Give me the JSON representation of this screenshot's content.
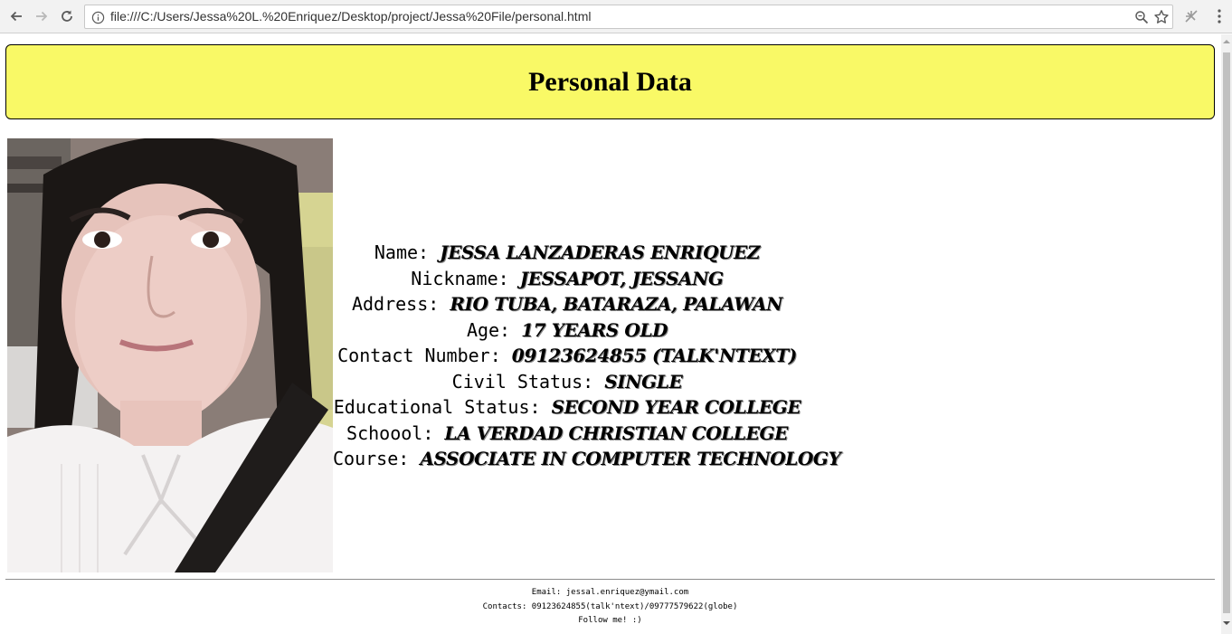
{
  "browser": {
    "url": "file:///C:/Users/Jessa%20L.%20Enriquez/Desktop/project/Jessa%20File/personal.html",
    "icons": {
      "back": "arrow-left-icon",
      "forward": "arrow-right-icon",
      "reload": "reload-icon",
      "info": "info-icon",
      "zoom": "zoom-icon",
      "bookmark": "star-icon",
      "extension": "extension-icon",
      "menu": "kebab-menu-icon"
    }
  },
  "page": {
    "header_title": "Personal Data",
    "header_bg": "#f9f966",
    "details": [
      {
        "label": "Name: ",
        "value": "Jessa Lanzaderas Enriquez"
      },
      {
        "label": "Nickname: ",
        "value": "Jessapot, Jessang"
      },
      {
        "label": "Address: ",
        "value": "Rio Tuba, Bataraza, Palawan"
      },
      {
        "label": "Age: ",
        "value": "17 years old"
      },
      {
        "label": "Contact Number: ",
        "value": "09123624855 (Talk'Ntext)"
      },
      {
        "label": "Civil Status: ",
        "value": "Single"
      },
      {
        "label": "Educational Status: ",
        "value": "Second Year College"
      },
      {
        "label": "Schoool: ",
        "value": "La Verdad Christian College"
      },
      {
        "label": "Course: ",
        "value": "Associate in Computer Technology"
      }
    ],
    "footer": {
      "email": "Email: jessal.enriquez@ymail.com",
      "contacts": "Contacts: 09123624855(talk'ntext)/09777579622(globe)",
      "follow": "Follow me! :)"
    }
  }
}
